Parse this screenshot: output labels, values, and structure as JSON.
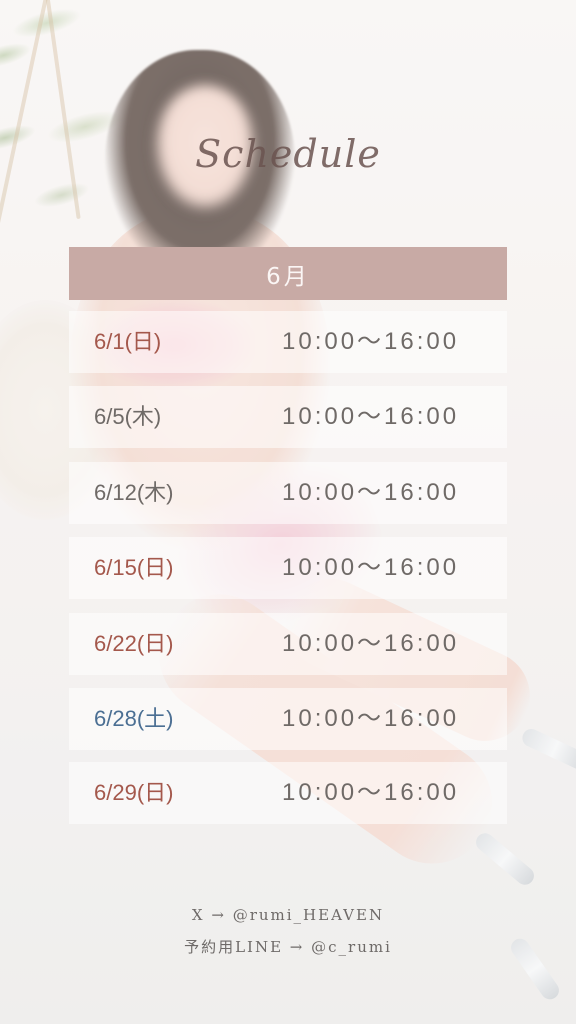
{
  "title": "Schedule",
  "month": "6月",
  "rows": [
    {
      "date": "6/1(日)",
      "time": "10:00〜16:00",
      "date_color": "#a4584c"
    },
    {
      "date": "6/5(木)",
      "time": "10:00〜16:00",
      "date_color": "#6f6a67"
    },
    {
      "date": "6/12(木)",
      "time": "10:00〜16:00",
      "date_color": "#6f6a67"
    },
    {
      "date": "6/15(日)",
      "time": "10:00〜16:00",
      "date_color": "#a4584c"
    },
    {
      "date": "6/22(日)",
      "time": "10:00〜16:00",
      "date_color": "#a4584c"
    },
    {
      "date": "6/28(土)",
      "time": "10:00〜16:00",
      "date_color": "#4b6f93"
    },
    {
      "date": "6/29(日)",
      "time": "10:00〜16:00",
      "date_color": "#a4584c"
    }
  ],
  "footer": {
    "x_line": "X → @rumi_HEAVEN",
    "line_line": "予約用LINE → @c_rumi"
  },
  "colors": {
    "month_bar": "#c8aaa5",
    "weekday_text": "#6f6a67",
    "sunday_text": "#a4584c",
    "saturday_text": "#4b6f93"
  }
}
